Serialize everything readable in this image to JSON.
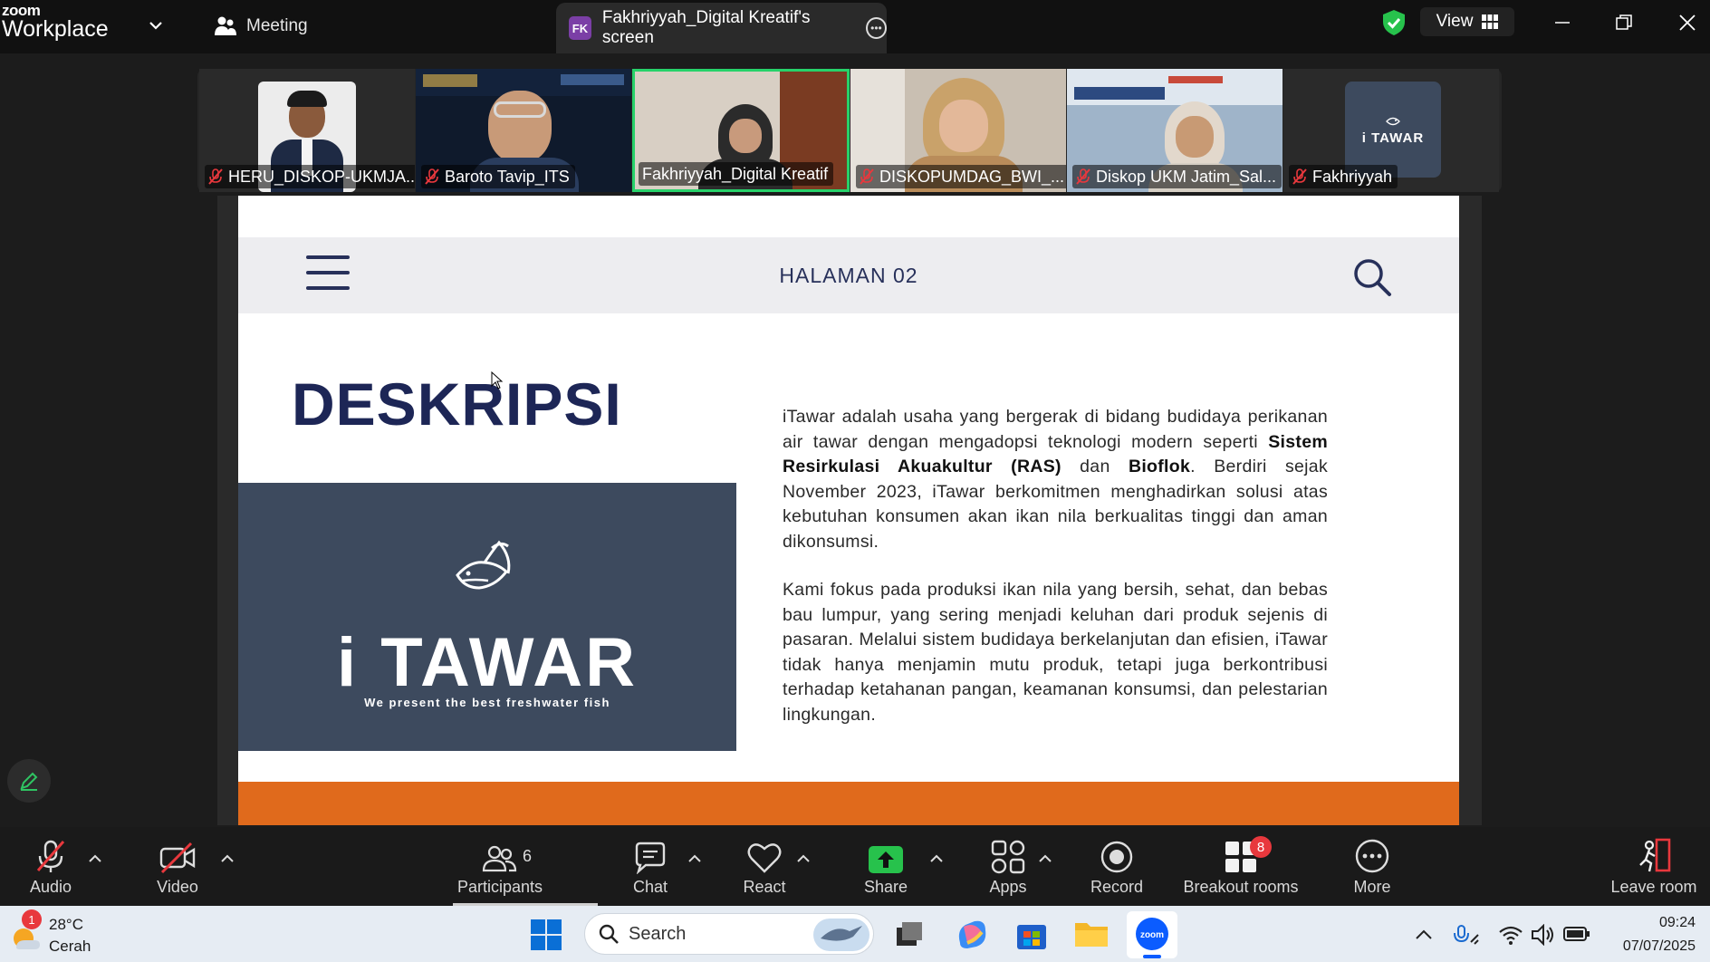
{
  "app": {
    "logo_top": "zoom",
    "logo_bottom": "Workplace",
    "meeting_label": "Meeting",
    "share_tab_initials": "FK",
    "share_tab_label": "Fakhriyyah_Digital Kreatif's screen",
    "view_label": "View"
  },
  "participants_strip": [
    {
      "name": "HERU_DISKOP-UKMJA...",
      "muted": true
    },
    {
      "name": "Baroto Tavip_ITS",
      "muted": true
    },
    {
      "name": "Fakhriyyah_Digital Kreatif",
      "muted": false,
      "active_speaker": true
    },
    {
      "name": "DISKOPUMDAG_BWI_...",
      "muted": true
    },
    {
      "name": "Diskop UKM Jatim_Sal...",
      "muted": true
    },
    {
      "name": "Fakhriyyah",
      "muted": true,
      "avatar_text": "i TAWAR"
    }
  ],
  "slide": {
    "page_label": "HALAMAN 02",
    "title": "DESKRIPSI",
    "brand_name": "i TAWAR",
    "brand_tagline": "We present the best freshwater fish",
    "para1_a": "iTawar adalah usaha yang bergerak di bidang budidaya perikanan air tawar dengan mengadopsi teknologi modern seperti ",
    "para1_b": "Sistem Resirkulasi Akuakultur (RAS)",
    "para1_c": " dan ",
    "para1_d": "Bioflok",
    "para1_e": ". Berdiri sejak November 2023, iTawar berkomitmen menghadirkan solusi atas kebutuhan konsumen akan ikan nila berkualitas tinggi dan aman dikonsumsi.",
    "para2": "Kami fokus pada produksi ikan nila yang bersih, sehat, dan bebas bau lumpur, yang sering menjadi keluhan dari produk sejenis di pasaran. Melalui sistem budidaya berkelanjutan dan efisien, iTawar tidak hanya menjamin mutu produk, tetapi juga berkontribusi terhadap ketahanan pangan, keamanan konsumsi, dan pelestarian lingkungan.",
    "accent_color": "#e06a1c",
    "title_color": "#1d2656",
    "brand_bg": "#3d4a5e"
  },
  "toolbar": {
    "audio": "Audio",
    "video": "Video",
    "participants": "Participants",
    "participants_count": "6",
    "chat": "Chat",
    "react": "React",
    "share": "Share",
    "apps": "Apps",
    "record": "Record",
    "breakout": "Breakout rooms",
    "breakout_badge": "8",
    "more": "More",
    "leave": "Leave room"
  },
  "taskbar": {
    "weather_badge": "1",
    "temperature": "28°C",
    "condition": "Cerah",
    "search_placeholder": "Search",
    "time": "09:24",
    "date": "07/07/2025"
  }
}
